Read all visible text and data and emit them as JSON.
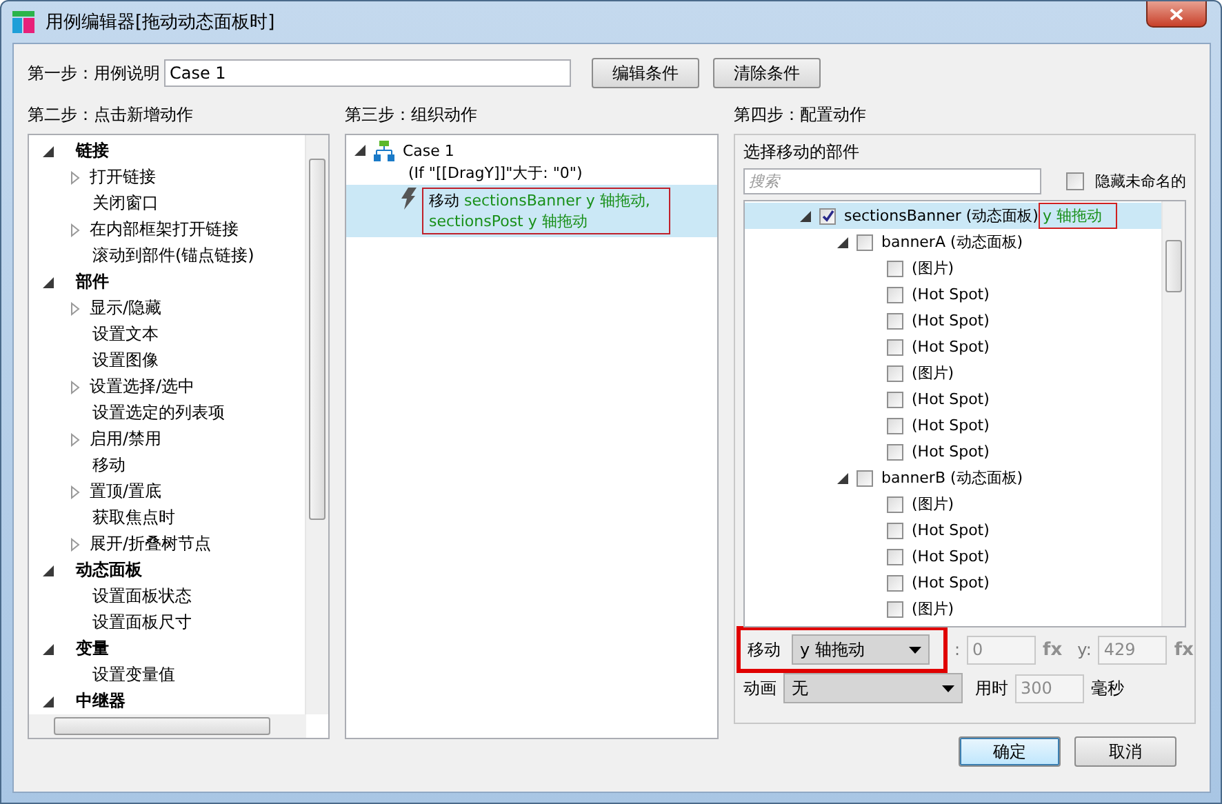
{
  "window": {
    "title": "用例编辑器[拖动动态面板时]"
  },
  "step1": {
    "label": "第一步：用例说明",
    "value": "Case 1",
    "buttons": [
      "编辑条件",
      "清除条件"
    ]
  },
  "step2": {
    "title": "第二步：点击新增动作",
    "groups": [
      {
        "label": "链接",
        "expanded": true,
        "children": [
          {
            "label": "打开链接",
            "expandable": true
          },
          {
            "label": "关闭窗口",
            "expandable": false
          },
          {
            "label": "在内部框架打开链接",
            "expandable": true
          },
          {
            "label": "滚动到部件(锚点链接)",
            "expandable": false
          }
        ]
      },
      {
        "label": "部件",
        "expanded": true,
        "children": [
          {
            "label": "显示/隐藏",
            "expandable": true
          },
          {
            "label": "设置文本",
            "expandable": false
          },
          {
            "label": "设置图像",
            "expandable": false
          },
          {
            "label": "设置选择/选中",
            "expandable": true
          },
          {
            "label": "设置选定的列表项",
            "expandable": false
          },
          {
            "label": "启用/禁用",
            "expandable": true
          },
          {
            "label": "移动",
            "expandable": false
          },
          {
            "label": "置顶/置底",
            "expandable": true
          },
          {
            "label": "获取焦点时",
            "expandable": false
          },
          {
            "label": "展开/折叠树节点",
            "expandable": true
          }
        ]
      },
      {
        "label": "动态面板",
        "expanded": true,
        "children": [
          {
            "label": "设置面板状态",
            "expandable": false
          },
          {
            "label": "设置面板尺寸",
            "expandable": false
          }
        ]
      },
      {
        "label": "变量",
        "expanded": true,
        "children": [
          {
            "label": "设置变量值",
            "expandable": false
          }
        ]
      },
      {
        "label": "中继器",
        "expanded": true
      }
    ]
  },
  "step3": {
    "title": "第三步：组织动作",
    "cases": [
      {
        "name": "Case 1",
        "condition": "(If \"[[DragY]]\"大于: \"0\")",
        "actions": [
          {
            "verb": "移动",
            "detail": "sectionsBanner y 轴拖动, sectionsPost y 轴拖动",
            "selected": true,
            "annotated": true
          }
        ]
      }
    ]
  },
  "step4": {
    "title": "第四步：配置动作",
    "subtitle": "选择移动的部件",
    "search": {
      "placeholder": "搜索"
    },
    "hide_unnamed": {
      "label": "隐藏未命名的",
      "checked": false
    },
    "widgets": [
      {
        "label": "sectionsBanner (动态面板)",
        "note": "y 轴拖动",
        "checked": true,
        "selected": true,
        "annotated": true,
        "children": [
          {
            "label": "bannerA (动态面板)",
            "checked": false,
            "selected": false,
            "children": [
              {
                "label": "(图片)",
                "checked": false,
                "selected": false
              },
              {
                "label": "(Hot Spot)",
                "checked": false,
                "selected": false
              },
              {
                "label": "(Hot Spot)",
                "checked": false,
                "selected": false
              },
              {
                "label": "(Hot Spot)",
                "checked": false,
                "selected": false
              },
              {
                "label": "(图片)",
                "checked": false,
                "selected": false
              },
              {
                "label": "(Hot Spot)",
                "checked": false,
                "selected": false
              },
              {
                "label": "(Hot Spot)",
                "checked": false,
                "selected": false
              },
              {
                "label": "(Hot Spot)",
                "checked": false,
                "selected": false
              }
            ]
          },
          {
            "label": "bannerB (动态面板)",
            "checked": false,
            "selected": false,
            "children": [
              {
                "label": "(图片)",
                "checked": false,
                "selected": false
              },
              {
                "label": "(Hot Spot)",
                "checked": false,
                "selected": false
              },
              {
                "label": "(Hot Spot)",
                "checked": false,
                "selected": false
              },
              {
                "label": "(Hot Spot)",
                "checked": false,
                "selected": false
              },
              {
                "label": "(图片)",
                "checked": false,
                "selected": false
              }
            ]
          }
        ]
      }
    ],
    "move": {
      "label": "移动",
      "value": "y 轴拖动",
      "annotated": true,
      "x_label": ":",
      "x_value": "0",
      "x_fx": "fx",
      "y_label": "y:",
      "y_value": "429",
      "y_fx": "fx"
    },
    "animation": {
      "label": "动画",
      "value": "无",
      "duration_label": "用时",
      "duration": "300",
      "unit": "毫秒"
    }
  },
  "buttons": [
    {
      "label": "确定",
      "default": true
    },
    {
      "label": "取消",
      "default": false
    }
  ]
}
